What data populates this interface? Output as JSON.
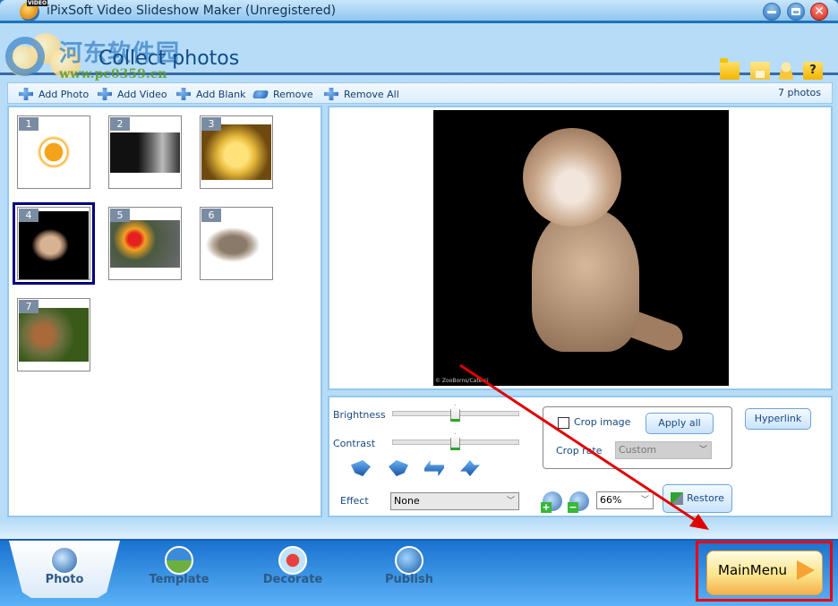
{
  "window": {
    "title": "iPixSoft Video Slideshow Maker (Unregistered)",
    "app_icon_tag": "VIDEO"
  },
  "header": {
    "section_title": "Collect photos",
    "watermark_line1": "河东软件园",
    "watermark_line2": "www.pc0359.cn",
    "tool_icons": [
      "open-folder-icon",
      "save-icon",
      "user-icon",
      "help-icon"
    ],
    "help_glyph": "?"
  },
  "toolbar": {
    "items": [
      {
        "label": "Add Photo",
        "icon": "add-photo-icon"
      },
      {
        "label": "Add Video",
        "icon": "add-video-icon"
      },
      {
        "label": "Add Blank",
        "icon": "add-blank-icon"
      },
      {
        "label": "Remove",
        "icon": "remove-icon"
      },
      {
        "label": "Remove All",
        "icon": "remove-all-icon"
      }
    ],
    "count": "7 photos"
  },
  "photos": [
    {
      "index": "1",
      "subject": "sun drawing",
      "selected": false
    },
    {
      "index": "2",
      "subject": "kitten",
      "selected": false
    },
    {
      "index": "3",
      "subject": "duckling",
      "selected": false
    },
    {
      "index": "4",
      "subject": "cheetah cub",
      "selected": true
    },
    {
      "index": "5",
      "subject": "golden pheasant",
      "selected": false
    },
    {
      "index": "6",
      "subject": "two kittens",
      "selected": false
    },
    {
      "index": "7",
      "subject": "squirrel",
      "selected": false
    }
  ],
  "preview": {
    "credit": "© ZooBorns/Catersi"
  },
  "controls": {
    "brightness_label": "Brightness",
    "brightness_value": 0.5,
    "contrast_label": "Contrast",
    "contrast_value": 0.5,
    "rotate_icons": [
      "rotate-left-icon",
      "rotate-right-icon",
      "flip-horizontal-icon",
      "flip-vertical-icon"
    ],
    "effect_label": "Effect",
    "effect_value": "None",
    "crop_image_label": "Crop image",
    "crop_image_checked": false,
    "apply_all_label": "Apply all",
    "crop_rate_label": "Crop rate",
    "crop_rate_value": "Custom",
    "hyperlink_label": "Hyperlink",
    "zoom_value": "66%",
    "restore_label": "Restore",
    "zoom_in_sign": "+",
    "zoom_out_sign": "−"
  },
  "bottom_nav": {
    "tabs": [
      {
        "label": "Photo",
        "active": true
      },
      {
        "label": "Template",
        "active": false
      },
      {
        "label": "Decorate",
        "active": false
      },
      {
        "label": "Publish",
        "active": false
      }
    ],
    "main_menu_label": "MainMenu"
  },
  "colors": {
    "accent_blue": "#1a72d0",
    "selection_border": "#000080",
    "highlight_red": "#e00000"
  }
}
